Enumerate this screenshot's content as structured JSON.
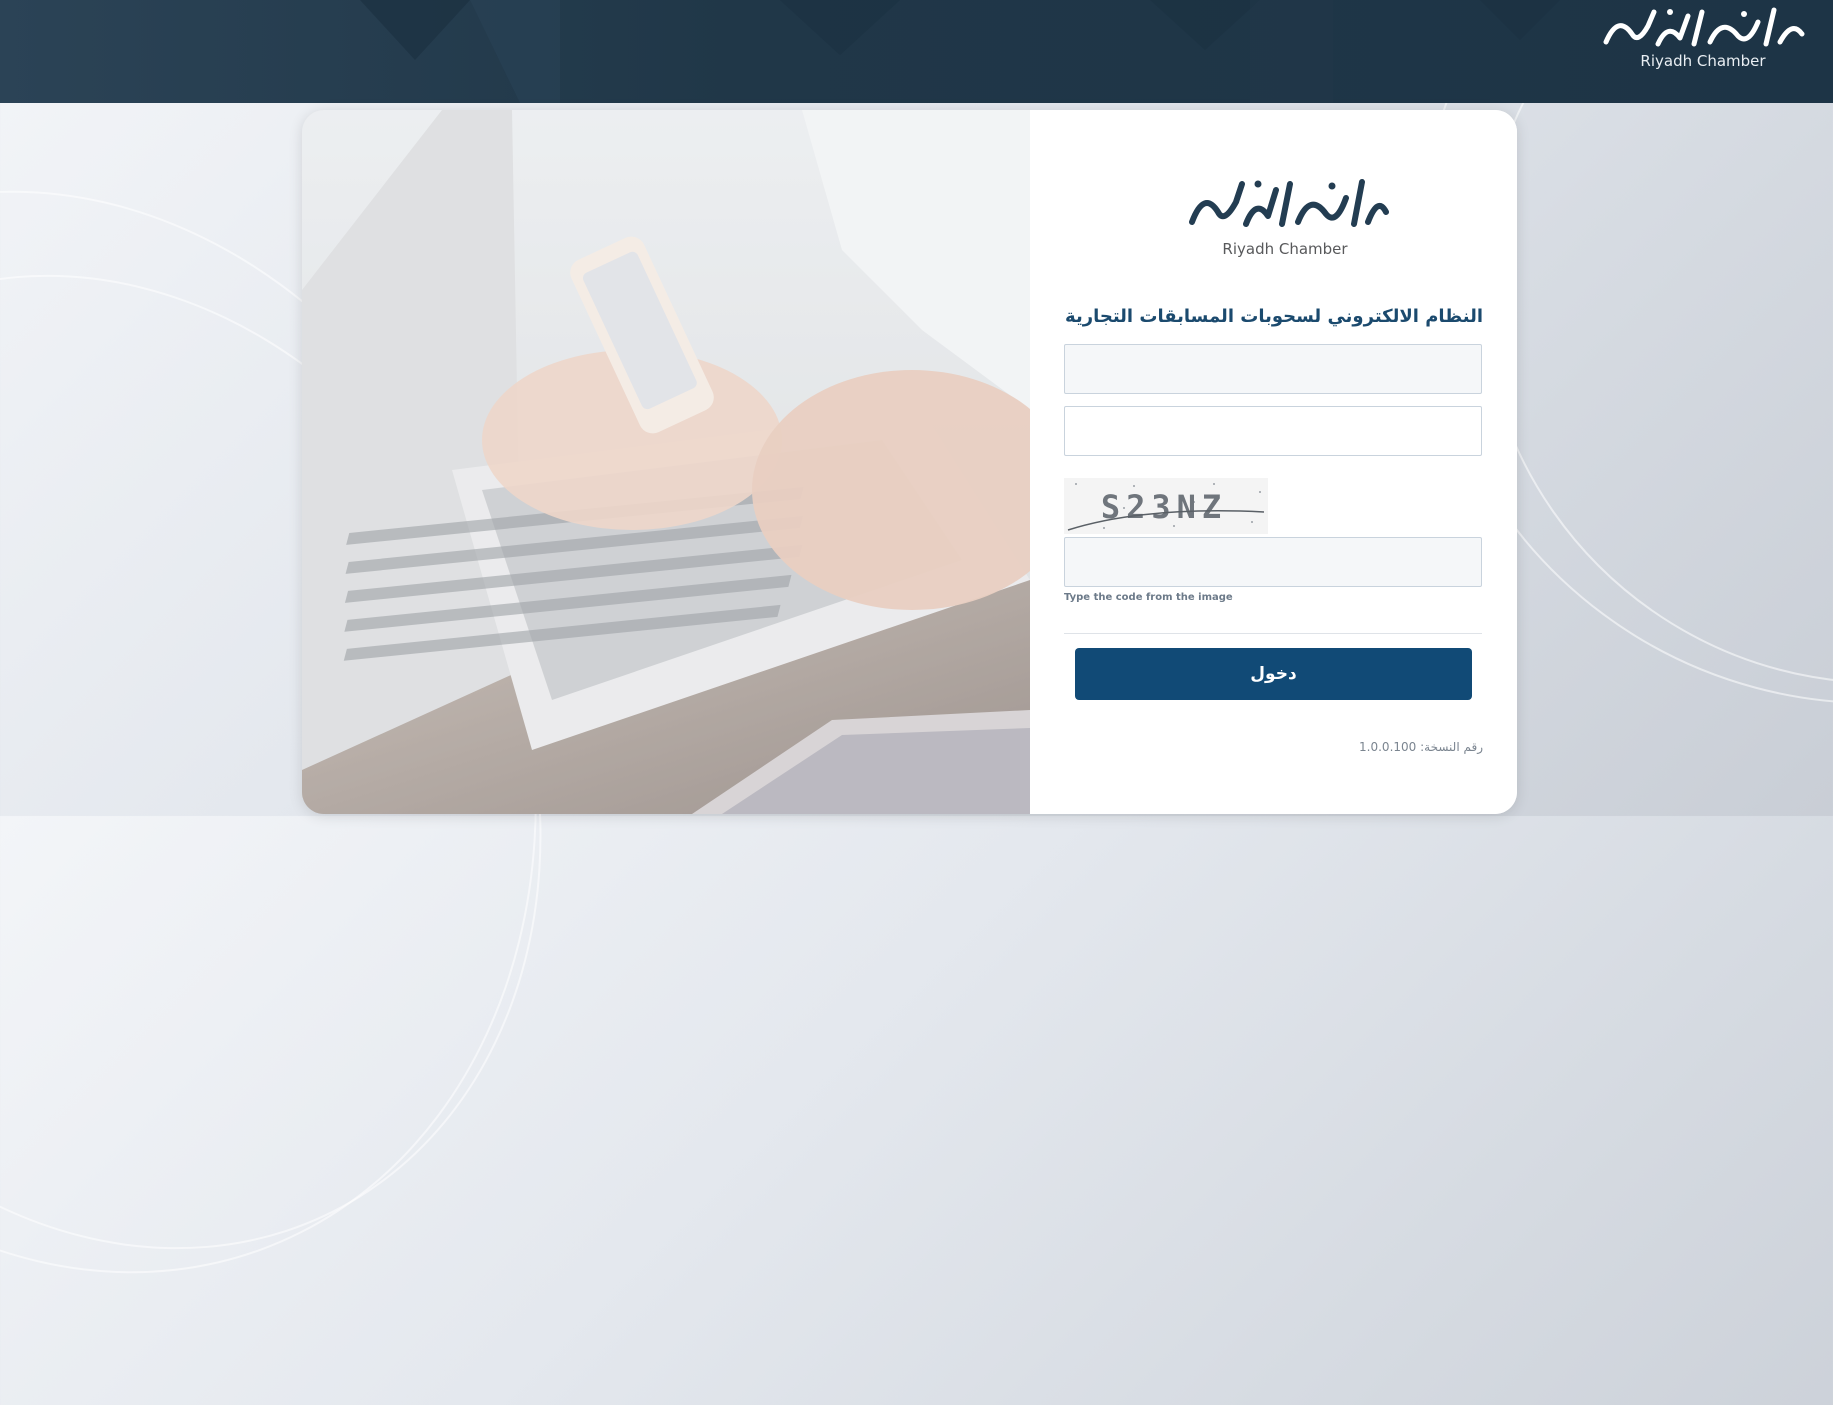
{
  "header": {
    "logo_arabic": "غرفة الرياض",
    "logo_english": "Riyadh Chamber"
  },
  "form": {
    "logo_arabic": "غرفة الرياض",
    "logo_english": "Riyadh Chamber",
    "title": "النظام الالكتروني لسحوبات المسابقات التجارية",
    "username_value": "",
    "password_value": "",
    "captcha_text": "S23NZ",
    "captcha_input_value": "",
    "captcha_hint": "Type the code from the image",
    "login_label": "دخول",
    "version_label": "رقم النسخة:",
    "version_value": "1.0.0.100"
  },
  "colors": {
    "header_bg": "#203748",
    "title": "#1b4a6e",
    "button": "#114a76"
  }
}
